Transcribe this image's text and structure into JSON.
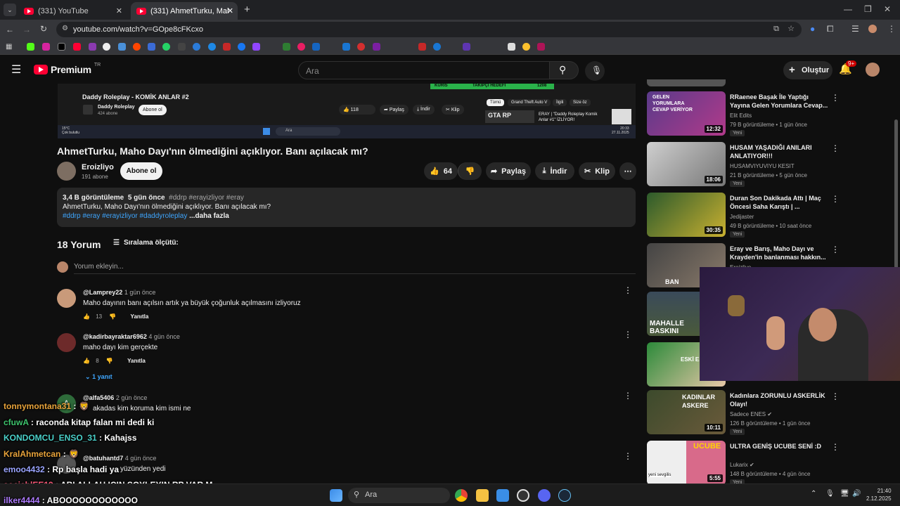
{
  "browser": {
    "tabs": [
      {
        "label": "(331) YouTube"
      },
      {
        "label": "(331) AhmetTurku, Maho Dayı'nı"
      }
    ],
    "new_tab": "+",
    "url": "youtube.com/watch?v=GOpe8cFKcxo"
  },
  "youtube": {
    "logo": "Premium",
    "logo_region": "TR",
    "search_placeholder": "Ara",
    "create_label": "Oluştur",
    "notif_count": "9+"
  },
  "embedded_video": {
    "title": "Daddy Roleplay - KOMİK ANLAR #2",
    "channel": "Daddy Roleplay",
    "subs": "424 abone",
    "subscribe": "Abone ol",
    "likes": "118",
    "share": "Paylaş",
    "download": "İndir",
    "clip": "Klip",
    "chips": [
      "Tümü",
      "Grand Theft Auto V",
      "İlgili",
      "Size öz"
    ],
    "side_title": "ERAY | \"Daddy Roleplay Komik Anlar #1\" İZLİYOR!",
    "gta_label": "GTA RP",
    "weather": "15°C",
    "weather_desc": "Çok bulutlu",
    "search": "Ara",
    "clock": "20:33",
    "date": "27.11.2025",
    "banner_left": "KÜRİS",
    "banner_mid": "TAKİPÇİ HEDEFİ",
    "banner_right": "1208"
  },
  "video": {
    "title": "AhmetTurku, Maho Dayı'nın ölmediğini açıklıyor. Banı açılacak mı?",
    "channel": "Eroizliyo",
    "subs": "191 abone",
    "subscribe": "Abone ol",
    "likes": "64",
    "share": "Paylaş",
    "download": "İndir",
    "clip": "Klip",
    "views": "3,4 B görüntüleme",
    "age": "5 gün önce",
    "tags": "#ddrp #erayizliyor #eray",
    "description": "AhmetTurku, Maho Dayı'nın ölmediğini açıklıyor. Banı açılacak mı?",
    "desc_tags": "#ddrp #eray #erayizliyor #daddyroleplay",
    "more": "...daha fazla"
  },
  "comments": {
    "count": "18 Yorum",
    "sort": "Sıralama ölçütü:",
    "add_placeholder": "Yorum ekleyin...",
    "reply_label": "Yanıtla",
    "items": [
      {
        "user": "@Lamprey22",
        "time": "1 gün önce",
        "text": "Maho dayının banı açılsın artık ya büyük çoğunluk açılmasını izliyoruz",
        "likes": "13"
      },
      {
        "user": "@kadirbayraktar6962",
        "time": "4 gün önce",
        "text": "maho dayı kim gerçekte",
        "likes": "8",
        "replies": "1 yanıt"
      },
      {
        "user": "@alfa5406",
        "time": "2 gün önce",
        "text": "akadas kim koruma kim ismi ne",
        "avatar_letter": "A"
      },
      {
        "user": "@batuhantd7",
        "time": "4 gün önce",
        "text": "yüzünden yedi"
      }
    ]
  },
  "sidebar": [
    {
      "title": "RRaenee Başak İle Yaptığı Yayına Gelen Yorumlara Cevap...",
      "channel": "Elit Edits",
      "meta": "79 B görüntüleme • 1 gün önce",
      "duration": "12:32",
      "badge": "Yeni",
      "thumb_text": "GELEN YORUMLARA CEVAP VERİYOR"
    },
    {
      "title": "HUSAM YAŞADIĞI ANILARI ANLATIYOR!!!",
      "channel": "HUSAMVIYUVIYU KESIT",
      "meta": "21 B görüntüleme • 5 gün önce",
      "duration": "18:06",
      "badge": "Yeni"
    },
    {
      "title": "Duran Son Dakikada Attı | Maç Öncesi Saha Karıştı | ...",
      "channel": "Jedijaster",
      "meta": "49 B görüntüleme • 10 saat önce",
      "duration": "30:35",
      "badge": "Yeni"
    },
    {
      "title": "Eray ve Barış, Maho Dayı ve Krayden'in banlanması hakkın...",
      "channel": "Eroizliyo",
      "meta": "",
      "duration": "",
      "badge": "",
      "thumb_text": "BAN"
    },
    {
      "title": "",
      "channel": "",
      "meta": "",
      "duration": "",
      "badge": "",
      "thumb_text": "MAHALLE BASKINI"
    },
    {
      "title": "",
      "channel": "",
      "meta": "",
      "duration": "",
      "badge": "",
      "thumb_text": "ESKİ E..."
    },
    {
      "title": "Kadınlara ZORUNLU ASKERLİK Olayı!",
      "channel": "Sadece ENES",
      "meta": "126 B görüntüleme • 1 gün önce",
      "duration": "10:11",
      "badge": "Yeni",
      "thumb_text": "KADINLAR ASKERE"
    },
    {
      "title": "ULTRA GENİŞ UCUBE SENİ :D",
      "channel": "Lukarix",
      "meta": "148 B görüntüleme • 4 gün önce",
      "duration": "5:55",
      "badge": "Yeni",
      "thumb_text": "UCUBE",
      "thumb_sub": "yeni sevgilis"
    }
  ],
  "chat": [
    {
      "user": "tonnymontana31",
      "msg": ":",
      "color": "#e8a33a"
    },
    {
      "user": "cfuwA",
      "msg": ": raconda kitap falan mi dedi ki",
      "color": "#3ec46d"
    },
    {
      "user": "KONDOMCU_ENSO_31",
      "msg": ": Kahajss",
      "color": "#4ad0c9"
    },
    {
      "user": "KralAhmetcan",
      "msg": ":",
      "color": "#e8a33a"
    },
    {
      "user": "emoo4432",
      "msg": ": Rp başla hadi ya",
      "color": "#9aa4ff"
    },
    {
      "user": "sociablEE19",
      "msg": ": ABI ALLAH ICIN SOYLEYIN RP VAR M",
      "color": "#ff5a7a"
    },
    {
      "user": "ilker4444",
      "msg": ": ABOOOOOOOOOOOO",
      "color": "#b07cff"
    }
  ],
  "taskbar": {
    "search": "Ara",
    "time": "21:40",
    "date": "2.12.2025"
  }
}
